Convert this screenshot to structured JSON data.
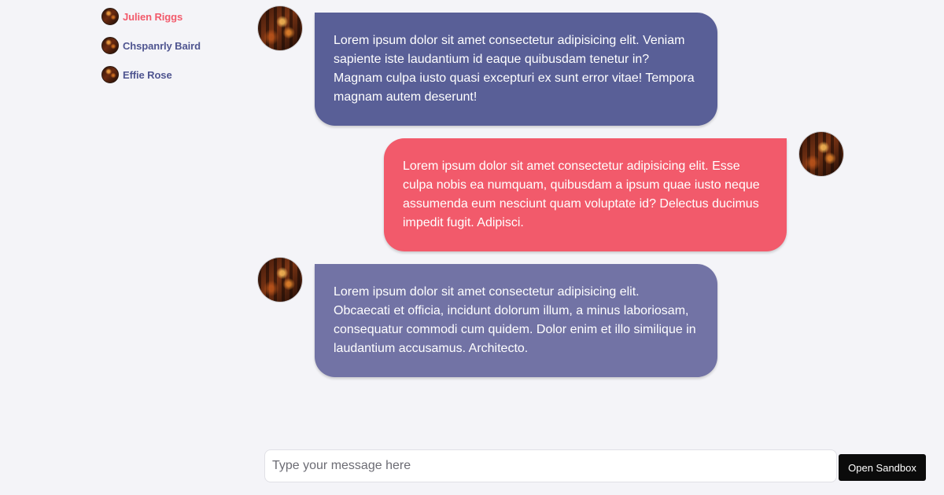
{
  "contacts": [
    {
      "name": "Julien Riggs",
      "active": true
    },
    {
      "name": "Chspanrly Baird",
      "active": false
    },
    {
      "name": "Effie Rose",
      "active": false
    }
  ],
  "messages": [
    {
      "direction": "incoming",
      "text": "Lorem ipsum dolor sit amet consectetur adipisicing elit. Veniam sapiente iste laudantium id eaque quibusdam tenetur in? Magnam culpa iusto quasi excepturi ex sunt error vitae! Tempora magnam autem deserunt!"
    },
    {
      "direction": "outgoing",
      "text": "Lorem ipsum dolor sit amet consectetur adipisicing elit. Esse culpa nobis ea numquam, quibusdam a ipsum quae iusto neque assumenda eum nesciunt quam voluptate id? Delectus ducimus impedit fugit. Adipisci."
    },
    {
      "direction": "incoming",
      "text": "Lorem ipsum dolor sit amet consectetur adipisicing elit. Obcaecati et officia, incidunt dolorum illum, a minus laboriosam, consequatur commodi cum quidem. Dolor enim et illo similique in laudantium accusamus. Architecto."
    }
  ],
  "composer": {
    "placeholder": "Type your message here",
    "value": ""
  },
  "sandbox_button": {
    "label": "Open Sandbox"
  },
  "colors": {
    "incoming_primary": "#595f97",
    "outgoing": "#f25a6b",
    "incoming_secondary": "#7273a5",
    "active_contact": "#f25a6b",
    "contact": "#4f5590",
    "background": "#f4f4f8"
  },
  "icons": {
    "contact_avatar": "avatar-photo",
    "message_avatar": "avatar-photo"
  }
}
